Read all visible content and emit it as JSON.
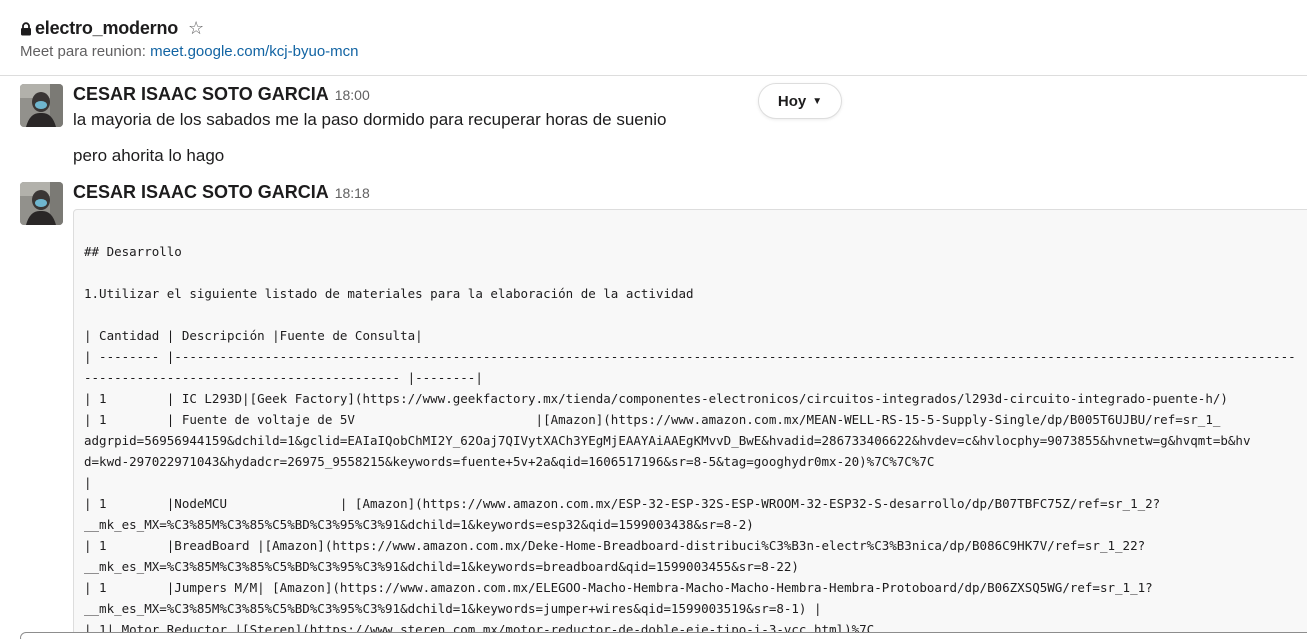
{
  "channel": {
    "name": "electro_moderno",
    "topic_prefix": "Meet para reunion: ",
    "topic_link": "meet.google.com/kcj-byuo-mcn",
    "lock_icon": "lock-icon",
    "star_icon": "star-icon"
  },
  "day_divider": {
    "label": "Hoy",
    "icon": "chevron-down-icon"
  },
  "messages": [
    {
      "sender": "CESAR ISAAC SOTO GARCIA",
      "time": "18:00",
      "lines": [
        "la mayoria de los sabados me la paso dormido para recuperar horas de suenio",
        "pero ahorita lo hago"
      ]
    },
    {
      "sender": "CESAR ISAAC SOTO GARCIA",
      "time": "18:18",
      "code_lines": [
        "## Desarrollo",
        "",
        "1.Utilizar el siguiente listado de materiales para la elaboración de la actividad",
        "",
        "| Cantidad | Descripción |Fuente de Consulta|",
        "| -------- |-----------------------------------------------------------------------------------------------------------------------------------------------------",
        "------------------------------------------ |--------|",
        "| 1        | IC L293D|[Geek Factory](https://www.geekfactory.mx/tienda/componentes-electronicos/circuitos-integrados/l293d-circuito-integrado-puente-h/)",
        "| 1        | Fuente de voltaje de 5V                        |[Amazon](https://www.amazon.com.mx/MEAN-WELL-RS-15-5-Supply-Single/dp/B005T6UJBU/ref=sr_1_",
        "adgrpid=56956944159&dchild=1&gclid=EAIaIQobChMI2Y_62Oaj7QIVytXACh3YEgMjEAAYAiAAEgKMvvD_BwE&hvadid=286733406622&hvdev=c&hvlocphy=9073855&hvnetw=g&hvqmt=b&hv",
        "d=kwd-297022971043&hydadcr=26975_9558215&keywords=fuente+5v+2a&qid=1606517196&sr=8-5&tag=googhydr0mx-20)%7C%7C%7C",
        "|",
        "| 1        |NodeMCU               | [Amazon](https://www.amazon.com.mx/ESP-32-ESP-32S-ESP-WROOM-32-ESP32-S-desarrollo/dp/B07TBFC75Z/ref=sr_1_2?",
        "__mk_es_MX=%C3%85M%C3%85%C5%BD%C3%95%C3%91&dchild=1&keywords=esp32&qid=1599003438&sr=8-2)",
        "| 1        |BreadBoard |[Amazon](https://www.amazon.com.mx/Deke-Home-Breadboard-distribuci%C3%B3n-electr%C3%B3nica/dp/B086C9HK7V/ref=sr_1_22?",
        "__mk_es_MX=%C3%85M%C3%85%C5%BD%C3%95%C3%91&dchild=1&keywords=breadboard&qid=1599003455&sr=8-22)",
        "| 1        |Jumpers M/M| [Amazon](https://www.amazon.com.mx/ELEGOO-Macho-Hembra-Macho-Macho-Hembra-Hembra-Protoboard/dp/B06ZXSQ5WG/ref=sr_1_1?",
        "__mk_es_MX=%C3%85M%C3%85%C5%BD%C3%95%C3%91&dchild=1&keywords=jumper+wires&qid=1599003519&sr=8-1) |",
        "| 1| Motor Reductor |[Steren](https://www.steren.com.mx/motor-reductor-de-doble-eje-tipo-i-3-vcc.html)%7C"
      ]
    }
  ],
  "colors": {
    "link": "#1264a3",
    "muted": "#616061",
    "code_bg": "#f8f8f8",
    "border": "#dddddd"
  }
}
